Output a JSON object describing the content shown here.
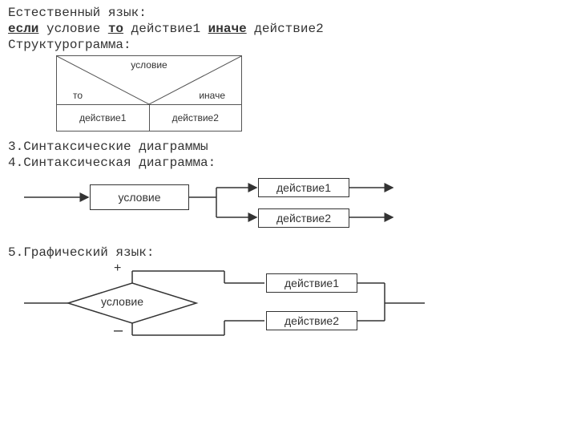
{
  "section1": {
    "title": "Естественный язык:",
    "w_if": "если",
    "w_cond": " условие ",
    "w_then": "то",
    "w_a1": " действие1 ",
    "w_else": "иначе",
    "w_a2": " действие2"
  },
  "section2": {
    "title": "Структурограмма:",
    "cond": "условие",
    "then": "то",
    "else": "иначе",
    "a1": "действие1",
    "a2": "действие2"
  },
  "section3": {
    "title": "3.Синтаксические диаграммы"
  },
  "section4": {
    "title": "4.Синтаксическая диаграмма:",
    "cond": "условие",
    "a1": "действие1",
    "a2": "действие2"
  },
  "section5": {
    "title": "5.Графический язык:",
    "plus": "+",
    "minus": "–",
    "cond": "условие",
    "a1": "действие1",
    "a2": "действие2"
  }
}
